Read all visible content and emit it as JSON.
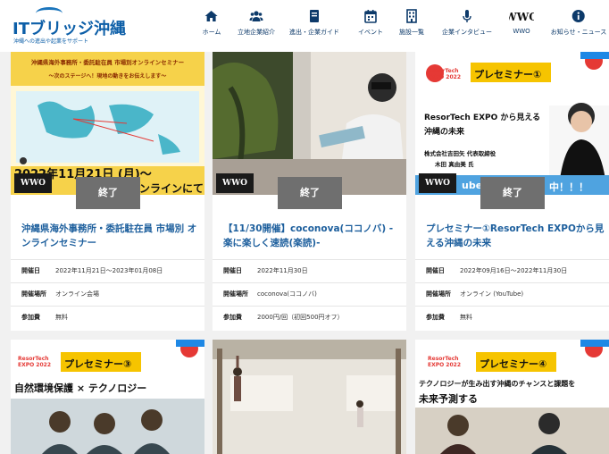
{
  "header": {
    "logo_title": "ITブリッジ沖縄",
    "logo_sub": "沖縄への進出や起業をサポート",
    "nav": [
      {
        "label": "ホーム",
        "icon": "home-icon"
      },
      {
        "label": "立地企業紹介",
        "icon": "users-icon"
      },
      {
        "label": "進出・企業ガイド",
        "icon": "book-icon"
      },
      {
        "label": "イベント",
        "icon": "calendar-icon"
      },
      {
        "label": "施設一覧",
        "icon": "building-icon"
      },
      {
        "label": "企業インタビュー",
        "icon": "microphone-icon"
      },
      {
        "label": "WWO",
        "icon": "wwo-logo-icon"
      },
      {
        "label": "お知らせ・ニュース",
        "icon": "info-icon"
      }
    ]
  },
  "badges": {
    "wwo": "WWO",
    "ended": "終了"
  },
  "labels": {
    "date": "開催日",
    "place": "開催場所",
    "fee": "参加費"
  },
  "cards": [
    {
      "title": "沖縄県海外事務所・委託駐在員 市場別 オンラインセミナー",
      "date": "2022年11月21日～2023年01月08日",
      "place": "オンライン会場",
      "fee": "無料",
      "thumb_text": {
        "banner": "沖縄県海外事務所・委託駐在員 市場別オンラインセミナー",
        "banner_sub": "～次のステージへ！現地の動きをお伝えします～",
        "date": "2022年11月21日 (月)～",
        "tail": "ンラインにて"
      }
    },
    {
      "title": "【11/30開催】coconova(ココノバ) -楽に楽しく速読(楽読)-",
      "date": "2022年11月30日",
      "place": "coconova(ココノバ)",
      "fee": "2000円/回（初回500円オフ）"
    },
    {
      "title": "プレセミナー①ResorTech EXPOから見える沖縄の未来",
      "date": "2022年09月16日～2022年11月30日",
      "place": "オンライン (YouTube)",
      "fee": "無料",
      "thumb_text": {
        "expo": "ResorTech EXPO 2022",
        "tag": "プレセミナー①",
        "heading": "ResorTech EXPO から見える",
        "heading2": "沖縄の未来",
        "company": "株式会社吉田矢 代表取締役",
        "person": "木田 真由美 氏",
        "tail_left": "ube",
        "tail_right": "中！！！"
      }
    }
  ],
  "bottom_cards": [
    {
      "expo": "ResorTech EXPO 2022",
      "tag": "プレセミナー③",
      "heading": "自然環境保護 × テクノロジー"
    },
    {},
    {
      "expo": "ResorTech EXPO 2022",
      "tag": "プレセミナー④",
      "heading": "テクノロジーが生み出す沖縄のチャンスと課題を",
      "heading2": "未来予測する"
    }
  ]
}
